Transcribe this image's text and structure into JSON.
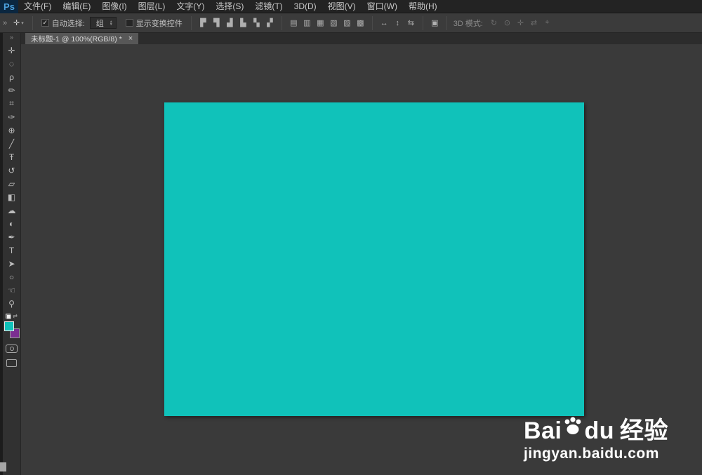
{
  "app": {
    "logo": "Ps",
    "menus": [
      "文件(F)",
      "编辑(E)",
      "图像(I)",
      "图层(L)",
      "文字(Y)",
      "选择(S)",
      "滤镜(T)",
      "3D(D)",
      "视图(V)",
      "窗口(W)",
      "帮助(H)"
    ]
  },
  "options": {
    "overflow_icon": "»",
    "move_icon": "✛",
    "tool_preset_arrow": "▾",
    "auto_select": {
      "check": "✓",
      "label": "自动选择:",
      "value": "组",
      "up": "▲",
      "down": "▼"
    },
    "transform": {
      "label": "显示变换控件"
    },
    "align_icons": [
      "▛",
      "▜",
      "▟",
      "▙",
      "▚",
      "▞"
    ],
    "distribute_icons": [
      "▤",
      "▥",
      "▦",
      "▧",
      "▨",
      "▩"
    ],
    "spread_icons": [
      "↔",
      "↕",
      "⇆"
    ],
    "auto_align_icon": "▣",
    "mode3d": {
      "label": "3D 模式:",
      "icons": [
        "↻",
        "⊙",
        "✛",
        "⇄",
        "⌖"
      ]
    }
  },
  "tab": {
    "title": "未标题-1 @ 100%(RGB/8) *",
    "close_icon": "×"
  },
  "toolbar": {
    "collapse_icon": "»",
    "switch_icon": "⇄",
    "tools": [
      "✛",
      "◌",
      "ρ",
      "✏",
      "⌗",
      "✑",
      "⊕",
      "╱",
      "Ŧ",
      "↺",
      "▱",
      "◧",
      "☁",
      "◐",
      "✒",
      "T",
      "➤",
      "○",
      "☜",
      "⚲"
    ]
  },
  "canvas": {
    "fill": "#10c2ba"
  },
  "colors": {
    "foreground": "#10c2ba",
    "background": "#7b2e91"
  },
  "watermark": {
    "brand_left": "Bai",
    "brand_right": "du",
    "brand_cn": "经验",
    "url": "jingyan.baidu.com"
  }
}
